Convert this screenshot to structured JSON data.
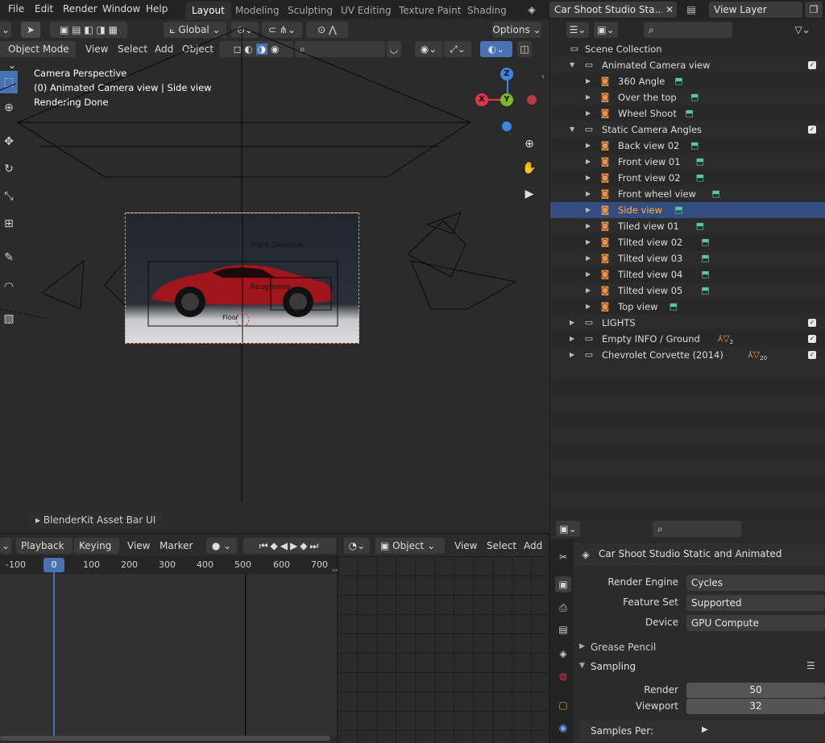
{
  "topbar": {
    "menus": [
      "File",
      "Edit",
      "Render",
      "Window",
      "Help"
    ],
    "workspace_tabs": [
      "Layout",
      "Modeling",
      "Sculpting",
      "UV Editing",
      "Texture Paint",
      "Shading"
    ],
    "active_tab": "Layout",
    "scene_name": "Car Shoot Studio Sta...",
    "view_layer": "View Layer"
  },
  "viewport_header": {
    "transform_orientation": "Global",
    "options_label": "Options",
    "mode": "Object Mode",
    "menus": [
      "View",
      "Select",
      "Add",
      "Object"
    ]
  },
  "viewport_overlay": {
    "line1": "Camera Perspective",
    "line2": "(0) Animated Camera view | Side view",
    "line3": "Rendering Done"
  },
  "scene_labels": {
    "front_direction": "Front Direction",
    "roughness": "Roughness",
    "floor": "Floor"
  },
  "gizmo": {
    "x": "X",
    "y": "Y",
    "z": "Z"
  },
  "asset_bar": {
    "label": "BlenderKit Asset Bar UI"
  },
  "outliner": {
    "root": "Scene Collection",
    "rows": [
      {
        "label": "Animated Camera view",
        "level": 1,
        "type": "collection",
        "expanded": true,
        "checked": true
      },
      {
        "label": "360 Angle",
        "level": 2,
        "type": "camera"
      },
      {
        "label": "Over the top",
        "level": 2,
        "type": "camera"
      },
      {
        "label": "Wheel Shoot",
        "level": 2,
        "type": "camera"
      },
      {
        "label": "Static Camera Angles",
        "level": 1,
        "type": "collection",
        "expanded": true,
        "checked": true
      },
      {
        "label": "Back view 02",
        "level": 2,
        "type": "camera"
      },
      {
        "label": "Front view 01",
        "level": 2,
        "type": "camera"
      },
      {
        "label": "Front view 02",
        "level": 2,
        "type": "camera"
      },
      {
        "label": "Front wheel view",
        "level": 2,
        "type": "camera"
      },
      {
        "label": "Side view",
        "level": 2,
        "type": "camera",
        "selected": true
      },
      {
        "label": "Tiled view 01",
        "level": 2,
        "type": "camera"
      },
      {
        "label": "Tilted view 02",
        "level": 2,
        "type": "camera"
      },
      {
        "label": "Tilted view 03",
        "level": 2,
        "type": "camera"
      },
      {
        "label": "Tilted view 04",
        "level": 2,
        "type": "camera"
      },
      {
        "label": "Tilted view 05",
        "level": 2,
        "type": "camera"
      },
      {
        "label": "Top view",
        "level": 2,
        "type": "camera"
      },
      {
        "label": "LIGHTS",
        "level": 1,
        "type": "collection",
        "checked": true
      },
      {
        "label": "Empty INFO / Ground",
        "level": 1,
        "type": "collection",
        "checked": true,
        "badge": "2"
      },
      {
        "label": "Chevrolet Corvette (2014)",
        "level": 1,
        "type": "collection",
        "checked": true,
        "badge": "20"
      }
    ]
  },
  "properties": {
    "title": "Car Shoot Studio Static and Animated",
    "render_engine_label": "Render Engine",
    "render_engine": "Cycles",
    "feature_set_label": "Feature Set",
    "feature_set": "Supported",
    "device_label": "Device",
    "device": "GPU Compute",
    "sections": [
      "Grease Pencil",
      "Sampling"
    ],
    "render_label": "Render",
    "render_samples": "50",
    "viewport_label": "Viewport",
    "viewport_samples": "32",
    "samples_per": "Samples Per:"
  },
  "timeline": {
    "menus": [
      "Playback",
      "Keying",
      "View",
      "Marker"
    ],
    "current_frame": "0",
    "ticks": [
      "-100",
      "0",
      "100",
      "200",
      "300",
      "400",
      "500",
      "600",
      "700"
    ]
  },
  "editor2": {
    "object_label": "Object",
    "menus": [
      "View",
      "Select",
      "Add"
    ]
  },
  "colors": {
    "accent": "#4772b3",
    "selected_row": "#334d80",
    "camera_orange": "#e8944a",
    "camera_data_green": "#59c7a4",
    "axis_x": "#e0384a",
    "axis_y": "#7fb922",
    "axis_z": "#3d87e0"
  }
}
